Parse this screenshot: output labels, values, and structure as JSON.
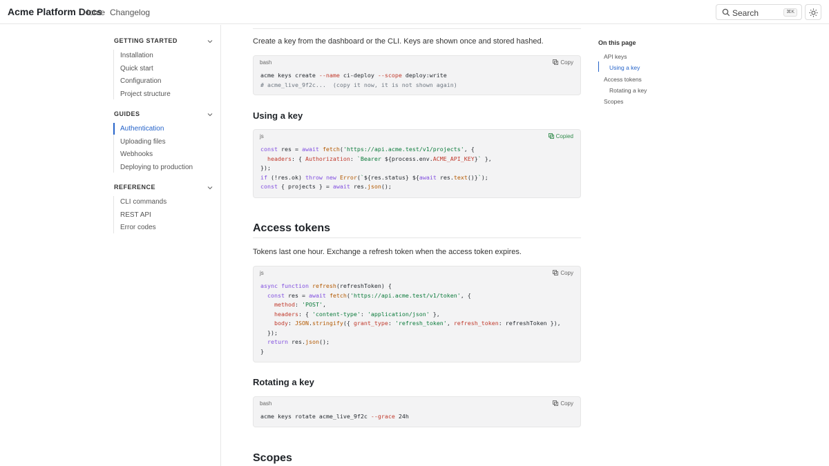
{
  "header": {
    "brand": "Acme Platform Docs",
    "nav": [
      "Home",
      "Changelog"
    ],
    "search_label": "Search",
    "search_shortcut": "⌘K",
    "theme_icon": "sun-icon"
  },
  "sidebar": {
    "sections": [
      {
        "title": "GETTING STARTED",
        "items": [
          "Installation",
          "Quick start",
          "Configuration",
          "Project structure"
        ]
      },
      {
        "title": "GUIDES",
        "items": [
          "Authentication",
          "Uploading files",
          "Webhooks",
          "Deploying to production"
        ],
        "active": "Authentication"
      },
      {
        "title": "REFERENCE",
        "items": [
          "CLI commands",
          "REST API",
          "Error codes"
        ]
      }
    ]
  },
  "content": {
    "intro": "Create a key from the dashboard or the CLI. Keys are shown once and stored hashed.",
    "block1": {
      "lang": "bash",
      "copy": "Copy"
    },
    "using_key_heading": "Using a key",
    "block2": {
      "lang": "js",
      "copy": "Copied"
    },
    "access_heading": "Access tokens",
    "access_para": "Tokens last one hour. Exchange a refresh token when the access token expires.",
    "block3": {
      "lang": "js",
      "copy": "Copy"
    },
    "rotating_heading": "Rotating a key",
    "block4": {
      "lang": "bash",
      "copy": "Copy"
    },
    "scopes_heading": "Scopes"
  },
  "toc": {
    "title": "On this page",
    "items": [
      "API keys",
      "Using a key",
      "Access tokens",
      "Rotating a key",
      "Scopes"
    ],
    "active": "Using a key"
  },
  "colors": {
    "accent": "#2563c9",
    "copied": "#2f8a4a",
    "code_bg": "#f3f3f4"
  }
}
